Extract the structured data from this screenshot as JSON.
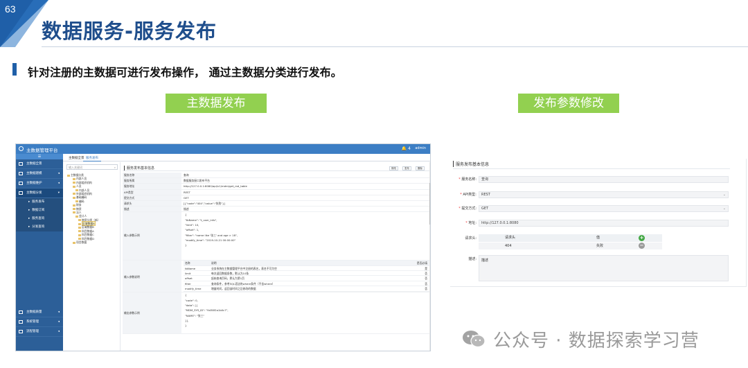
{
  "slide": {
    "number": "63",
    "title": "数据服务-服务发布",
    "subtitle": "针对注册的主数据可进行发布操作，  通过主数据分类进行发布。",
    "label_left": "主数据发布",
    "label_right": "发布参数修改",
    "watermark": "公众号 · 数据探索学习营",
    "colors": {
      "title": "#1f4e8c",
      "accent_green": "#92d050",
      "corner_blue": "#1f5fa8"
    }
  },
  "app": {
    "name": "主数据管理平台",
    "bell_count": "4",
    "user": "admin",
    "tabs": [
      "主数据全景",
      "服务发布"
    ],
    "side_head": "☰",
    "sidebar": [
      {
        "label": "主数据全景",
        "arrow": ""
      },
      {
        "label": "主数据建模",
        "arrow": "◂"
      },
      {
        "label": "主数据维护",
        "arrow": "◂"
      },
      {
        "label": "主数据分发",
        "arrow": "▾"
      }
    ],
    "sidebar_sub": [
      "服务发布",
      "数据订阅",
      "服务查询",
      "分发查询"
    ],
    "sidebar_bottom": [
      {
        "label": "主数据质量",
        "arrow": "◂"
      },
      {
        "label": "系统管理",
        "arrow": "◂"
      },
      {
        "label": "流程管理",
        "arrow": "◂"
      }
    ],
    "tree_search_placeholder": "输入关键词",
    "tree": [
      "主数据分类",
      "内部人员",
      "内部组织机构",
      "人员",
      "内部人员",
      "外部组织机构",
      "基础编码",
      "编码",
      "财务",
      "物资",
      "法人",
      "会计人",
      "物资分类（新）",
      "区域数据A",
      "区域数据B",
      "科目数据A",
      "科目数据C",
      "科目数据D",
      "项目数据"
    ],
    "detail_title": "服务发布基本信息",
    "buttons": [
      "修改",
      "发布",
      "删除"
    ],
    "fields": [
      {
        "k": "服务名称",
        "v": "查询"
      },
      {
        "k": "服务所属",
        "v": "数据服务接口发布平台"
      },
      {
        "k": "服务地址",
        "v": "http://127.0.0.1:8080/api/v1/mdm/get_md_table"
      },
      {
        "k": "API类型",
        "v": "REST"
      },
      {
        "k": "提交方式",
        "v": "GET"
      },
      {
        "k": "请求头",
        "v": "[{\"code\":\"404\",\"value\":\"失败\"}]"
      },
      {
        "k": "描述",
        "v": "描述"
      }
    ],
    "input_example_label": "输入参数示例",
    "input_example": [
      "{",
      "\"tbName\": \"t_user_info\",",
      "\"limit\": 10,",
      "\"offset\": 1,",
      "\"filter\": \"name like '张三' and age > 18\",",
      "\"modify_time\": \"2019-10-21 00:00:00\"",
      "}"
    ],
    "param_desc_label": "输入参数说明",
    "param_headers": [
      "名称",
      "说明",
      "是否必填"
    ],
    "params": [
      {
        "n": "tbName",
        "d": "业务系统在主数据管理平台中注册的表名，表名不可为空",
        "r": "是"
      },
      {
        "n": "limit",
        "d": "每次返回数据条数，默认为10条",
        "r": "否"
      },
      {
        "n": "offset",
        "d": "起始查询页码，默认为第1页",
        "r": "否"
      },
      {
        "n": "filter",
        "d": "查询条件，参考SQL语法的where条件（不含where）",
        "r": "否"
      },
      {
        "n": "modify_time",
        "d": "增量时间，返回该时间之后修改的数据",
        "r": "否"
      }
    ],
    "output_example_label": "输出参数示例",
    "output_example": [
      "{",
      "\"code\": 0,",
      "\"data\": [{",
      "\"MDM_SYS_ID\": \"9d38f2a1b0c7\",",
      "\"NAME\": \"张三\"",
      "}],",
      "}"
    ]
  },
  "form": {
    "title": "服务发布基本信息",
    "fields": [
      {
        "label": "服务名称:",
        "value": "查询",
        "required": true,
        "dropdown": false
      },
      {
        "label": "API类型:",
        "value": "REST",
        "required": true,
        "dropdown": true
      },
      {
        "label": "提交方式:",
        "value": "GET",
        "required": true,
        "dropdown": true
      },
      {
        "label": "地址:",
        "value": "http://127.0.0.1:8080",
        "required": true,
        "dropdown": false
      }
    ],
    "headers_label": "请求头:",
    "table_headers": [
      "请求头",
      "值"
    ],
    "table_rows": [
      {
        "a": "404",
        "b": "失败"
      }
    ],
    "add_icon": "+",
    "remove_icon": "−",
    "desc_label": "描述:",
    "desc_value": "描述"
  }
}
